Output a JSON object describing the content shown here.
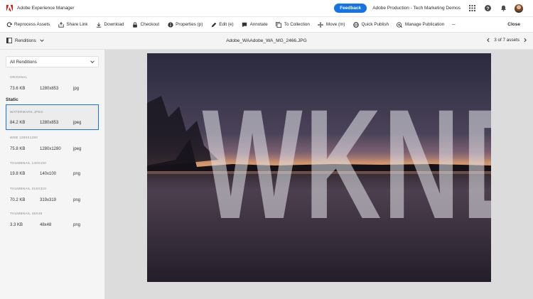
{
  "header": {
    "app_title": "Adobe Experience Manager",
    "feedback_label": "Feedback",
    "org_name": "Adobe Production - Tech Marketing Demos",
    "icons": [
      "apps-icon",
      "help-icon",
      "bell-icon"
    ]
  },
  "toolbar": {
    "items": [
      {
        "label": "Reprocess Assets",
        "icon": "refresh-icon"
      },
      {
        "label": "Share Link",
        "icon": "share-icon"
      },
      {
        "label": "Download",
        "icon": "download-icon"
      },
      {
        "label": "Checkout",
        "icon": "lock-icon"
      },
      {
        "label": "Properties (p)",
        "icon": "info-icon"
      },
      {
        "label": "Edit (e)",
        "icon": "pencil-icon"
      },
      {
        "label": "Annotate",
        "icon": "comment-icon"
      },
      {
        "label": "To Collection",
        "icon": "collection-icon"
      },
      {
        "label": "Move (m)",
        "icon": "move-icon"
      },
      {
        "label": "Quick Publish",
        "icon": "globe-icon"
      },
      {
        "label": "Manage Publication",
        "icon": "publication-icon"
      }
    ],
    "more_label": "···",
    "close_label": "Close"
  },
  "subbar": {
    "renditions_label": "Renditions",
    "file_name": "Adobe_WAAdobe_WA_MG_2466.JPG",
    "pager": "3 of 7 assets"
  },
  "panel": {
    "dropdown_value": "All Renditions",
    "static_label": "Static",
    "renditions": [
      {
        "name": "ORIGINAL",
        "size": "73.6 KB",
        "dims": "1280x853",
        "type": "jpg"
      },
      {
        "name": "WATERMARK.JPEG",
        "size": "84.2 KB",
        "dims": "1280x853",
        "type": "jpeg"
      },
      {
        "name": "WEB 1280X1280",
        "size": "75.8 KB",
        "dims": "1280x1280",
        "type": "jpeg"
      },
      {
        "name": "THUMBNAIL 140X100",
        "size": "19.8 KB",
        "dims": "140x100",
        "type": "png"
      },
      {
        "name": "THUMBNAIL 319X319",
        "size": "70.2 KB",
        "dims": "319x319",
        "type": "png"
      },
      {
        "name": "THUMBNAIL 48X48",
        "size": "3.3 KB",
        "dims": "48x48",
        "type": "png"
      }
    ]
  },
  "preview": {
    "watermark_text": "WKND"
  },
  "colors": {
    "accent": "#1473e6",
    "brand": "#eb1000"
  }
}
